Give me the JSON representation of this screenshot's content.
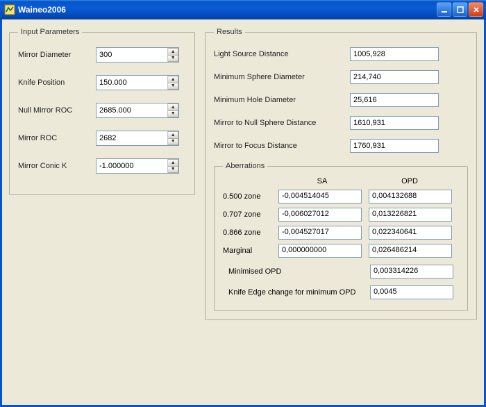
{
  "window": {
    "title": "Waineo2006"
  },
  "inputs": {
    "legend": "Input Parameters",
    "mirror_diameter": {
      "label": "Mirror Diameter",
      "value": "300"
    },
    "knife_position": {
      "label": "Knife Position",
      "value": "150.000"
    },
    "null_mirror_roc": {
      "label": "Null Mirror ROC",
      "value": "2685.000"
    },
    "mirror_roc": {
      "label": "Mirror ROC",
      "value": "2682"
    },
    "mirror_conic_k": {
      "label": "Mirror Conic K",
      "value": "-1.000000"
    }
  },
  "results": {
    "legend": "Results",
    "light_source_distance": {
      "label": "Light Source Distance",
      "value": "1005,928"
    },
    "min_sphere_diameter": {
      "label": "Minimum Sphere Diameter",
      "value": "214,740"
    },
    "min_hole_diameter": {
      "label": "Minimum Hole Diameter",
      "value": "25,616"
    },
    "mirror_to_null_sphere": {
      "label": "Mirror to Null Sphere Distance",
      "value": "1610,931"
    },
    "mirror_to_focus": {
      "label": "Mirror to Focus Distance",
      "value": "1760,931"
    }
  },
  "aberrations": {
    "legend": "Aberrations",
    "col1": "SA",
    "col2": "OPD",
    "rows": [
      {
        "label": "0.500 zone",
        "sa": "-0,004514045",
        "opd": "0,004132688"
      },
      {
        "label": "0.707 zone",
        "sa": "-0,006027012",
        "opd": "0,013226821"
      },
      {
        "label": "0.866 zone",
        "sa": "-0,004527017",
        "opd": "0,022340641"
      },
      {
        "label": "Marginal",
        "sa": "0,000000000",
        "opd": "0,026486214"
      }
    ],
    "min_opd": {
      "label": "Minimised OPD",
      "value": "0,003314226"
    },
    "knife_edge_change": {
      "label": "Knife Edge change for minimum OPD",
      "value": "0,0045"
    }
  }
}
